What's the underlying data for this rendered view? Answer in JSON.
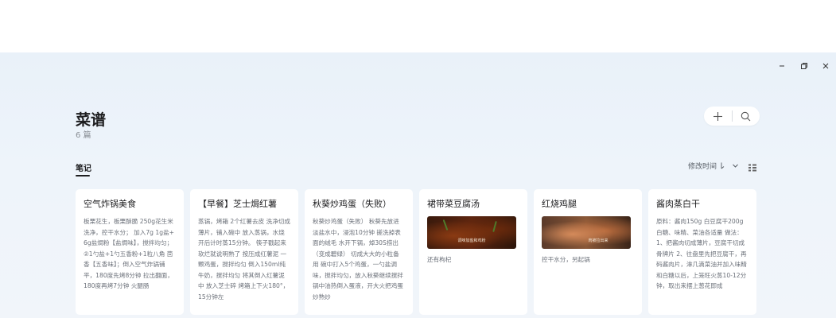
{
  "window": {
    "minimize": "minimize",
    "maximize": "maximize",
    "close": "close"
  },
  "header": {
    "title": "菜谱",
    "count": "6 篇"
  },
  "tabs": [
    {
      "label": "笔记",
      "active": true
    }
  ],
  "sort": {
    "label": "修改时间"
  },
  "notes": [
    {
      "title": "空气炸锅美食",
      "body": "板栗花生，板栗酥脆 250g花生米洗净，控干水分； 加入7g 1g盐+6g盐焗粉【盐焗味】，搅拌均匀； ②1勺盐+1勺五香粉+1粒八角 茴香【五香味】；倒入空气炸锅铺平，180度先烤8分钟 拉出翻面，180度再烤7分钟 火腿肠"
    },
    {
      "title": "【早餐】芝士焗红薯",
      "body": "蒸锅，烤箱 2个红薯去皮 洗净切成薄片，铺入碗中 放入蒸锅，水烧开后计时蒸15分钟。 筷子戳起来软烂就说明熟了 按压成红薯泥 一颗鸡蛋，搅拌均匀 倒入150ml纯牛奶，搅拌均匀 将其倒入红薯泥中 放入芝士碎 烤箱上下火180°，15分钟左"
    },
    {
      "title": "秋葵炒鸡蛋（失败）",
      "body": "秋葵炒鸡蛋（失败） 秋葵先放进淡盐水中，浸泡10分钟 搓洗掉表面的绒毛 水开下锅，焯30S捞出（变成碧绿） 切成大大的小粒备用 碗中打入5个鸡蛋，一勺盐调味，搅拌均匀，放入秋葵继续搅拌 锅中油热倒入蛋液，开大火把鸡蛋炒熟炒"
    },
    {
      "title": "裙带菜豆腐汤",
      "image_caption": "调味加盐和鸡粉",
      "body": "还有枸杞"
    },
    {
      "title": "红烧鸡腿",
      "image_caption": "肉被拉出来",
      "body": "控干水分，另起锅"
    },
    {
      "title": "酱肉蒸白干",
      "body": "原料：酱肉150g 白豆腐干200g 白糖、味精、菜油各适量 做法：1、把酱肉切成薄片，豆腐干切成骨牌片 2、往盘里先把豆腐干，再码酱肉片，淋几滴菜油并加入味精和白糖以后，上笼旺火蒸10-12分钟，取出来摆上葱花即成"
    }
  ]
}
